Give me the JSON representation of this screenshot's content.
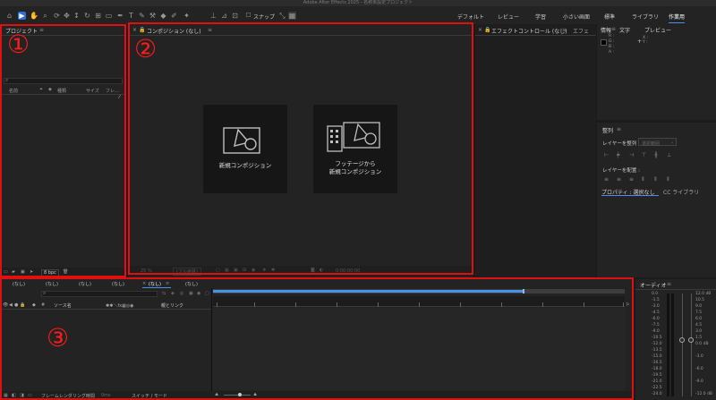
{
  "window_title": "Adobe After Effects 2025 - 名称未設定プロジェクト",
  "toolbar": {
    "snap_label": "スナップ",
    "workspaces": [
      "デフォルト",
      "レビュー",
      "学習",
      "小さい画面",
      "標準",
      "ライブラリ",
      "作業用"
    ],
    "active_workspace": "作業用"
  },
  "project_panel": {
    "title": "プロジェクト",
    "menu": "≡",
    "columns": [
      "名前",
      "種類",
      "サイズ",
      "フレ..."
    ],
    "bpc": "8 bpc"
  },
  "composition_panel": {
    "title": "コンポジション (なし)",
    "new_comp_label": "新規コンポジション",
    "from_footage_line1": "フッテージから",
    "from_footage_line2": "新規コンポジション",
    "zoom": "25 %",
    "resolution": "(フル画質)",
    "time": "0;00;00;00"
  },
  "effects_panel": {
    "title": "エフェクトコントロール (なし)",
    "next_tab": "エフェ"
  },
  "info_panel": {
    "tabs": [
      "情報",
      "文字",
      "プレビュー"
    ],
    "rgb": [
      "R :",
      "G :",
      "B :",
      "A :"
    ],
    "xy": [
      "X :",
      "Y :"
    ]
  },
  "align_panel": {
    "title": "整列",
    "align_to_label": "レイヤーを整列 :",
    "align_to_value": "選択範囲",
    "distribute_label": "レイヤーを配置 :"
  },
  "properties_panel": {
    "tab_properties": "プロパティ : 選択なし",
    "tab_libraries": "CC ライブラリ"
  },
  "timeline": {
    "tabs": [
      "(なし)",
      "(なし)",
      "(なし)",
      "(なし)",
      "(なし)",
      "(なし)"
    ],
    "columns": [
      "ソース名",
      "親とリンク"
    ],
    "footer_render": "フレームレンダリング時間",
    "footer_render_value": "0ms",
    "footer_switch": "スイッチ / モード"
  },
  "audio_panel": {
    "title": "オーディオ",
    "left_scale": [
      "0.0",
      "-1.5",
      "-3.0",
      "-4.5",
      "-6.0",
      "-7.5",
      "-9.0",
      "-10.5",
      "-12.0",
      "-13.5",
      "-15.0",
      "-16.5",
      "-18.0",
      "-19.5",
      "-21.0",
      "-22.5",
      "-24.0"
    ],
    "right_scale": [
      "12.0 dB",
      "10.5",
      "9.0",
      "7.5",
      "6.0",
      "4.5",
      "3.0",
      "1.5",
      "0.0 dB",
      "",
      "-3.0",
      "",
      "-6.0",
      "",
      "-9.0",
      "",
      "-12.0 dB"
    ]
  },
  "annotations": {
    "n1": "①",
    "n2": "②",
    "n3": "③"
  },
  "colors": {
    "annotation_red": "#e01010",
    "accent_blue": "#2e6fd8"
  }
}
